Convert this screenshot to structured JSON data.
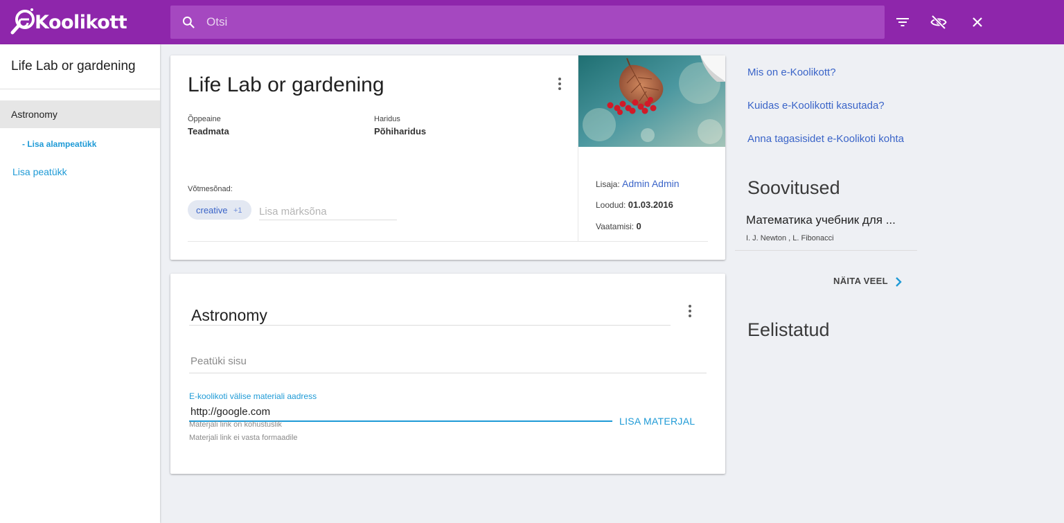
{
  "header": {
    "logo_text": "Koolikott",
    "search_placeholder": "Otsi",
    "icons": [
      "filter-icon",
      "visibility-off-icon",
      "close-icon"
    ]
  },
  "sidebar": {
    "title": "Life Lab or gardening",
    "chapters": [
      {
        "label": "Astronomy",
        "active": true
      }
    ],
    "add_subchapter_label": "- Lisa alampeatükk",
    "add_chapter_label": "Lisa peatükk"
  },
  "portfolio": {
    "title": "Life Lab or gardening",
    "subject_label": "Õppeaine",
    "subject_value": "Teadmata",
    "education_label": "Haridus",
    "education_value": "Põhiharidus",
    "keywords_label": "Võtmesõnad:",
    "keyword_chip": "creative",
    "keyword_more": "+1",
    "keyword_placeholder": "Lisa märksõna",
    "author_label": "Lisaja:",
    "author_name": "Admin Admin",
    "created_label": "Loodud:",
    "created_value": "01.03.2016",
    "views_label": "Vaatamisi:",
    "views_value": "0"
  },
  "chapter": {
    "title": "Astronomy",
    "content_placeholder": "Peatüki sisu",
    "url_label": "E-koolikoti välise materiali aadress",
    "url_value": "http://google.com",
    "error_required": "Materjali link on kohustuslik",
    "error_format": "Materjali link ei vasta formaadile",
    "add_material_label": "LISA MATERJAL"
  },
  "right_panel": {
    "links": [
      "Mis on e-Koolikott?",
      "Kuidas e-Koolikotti kasutada?",
      "Anna tagasisidet e-Koolikoti kohta"
    ],
    "recommendations_heading": "Soovitused",
    "recommendation": {
      "title": "Математика учебник для ...",
      "authors": "I. J. Newton , L. Fibonacci"
    },
    "show_more_label": "NÄITA VEEL",
    "favorites_heading": "Eelistatud"
  },
  "colors": {
    "header": "#8e26ab",
    "search": "#a548c0",
    "accent": "#1e9ad6",
    "link": "#3a64c8"
  }
}
